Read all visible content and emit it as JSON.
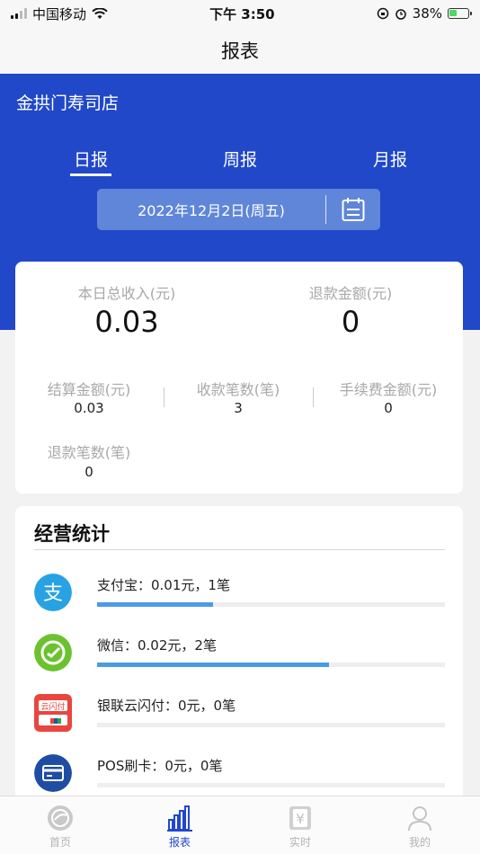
{
  "status_bar": {
    "carrier": "中国移动",
    "time": "下午 3:50",
    "battery": "38%"
  },
  "nav": {
    "title": "报表"
  },
  "store": {
    "name": "金拱门寿司店"
  },
  "tabs": [
    {
      "label": "日报"
    },
    {
      "label": "周报"
    },
    {
      "label": "月报"
    }
  ],
  "date": {
    "value": "2022年12月2日(周五)"
  },
  "summary": {
    "total_income_label": "本日总收入(元)",
    "total_income": "0.03",
    "refund_amount_label": "退款金额(元)",
    "refund_amount": "0",
    "settle_label": "结算金额(元)",
    "settle_value": "0.03",
    "count_label": "收款笔数(笔)",
    "count_value": "3",
    "fee_label": "手续费金额(元)",
    "fee_value": "0",
    "refund_count_label": "退款笔数(笔)",
    "refund_count_value": "0"
  },
  "stats": {
    "title": "经营统计",
    "items": [
      {
        "text": "支付宝：0.01元，1笔",
        "ratio": 0.333,
        "icon": "alipay-icon"
      },
      {
        "text": "微信：0.02元，2笔",
        "ratio": 0.667,
        "icon": "wechat-icon"
      },
      {
        "text": "银联云闪付：0元，0笔",
        "ratio": 0,
        "icon": "unionpay-icon",
        "icon_text": "云闪付"
      },
      {
        "text": "POS刷卡：0元，0笔",
        "ratio": 0,
        "icon": "card-icon"
      }
    ]
  },
  "tabbar": {
    "items": [
      {
        "label": "首页"
      },
      {
        "label": "报表"
      },
      {
        "label": "实时"
      },
      {
        "label": "我的"
      }
    ],
    "active": 1
  },
  "colors": {
    "primary": "#2148c9",
    "progress": "#4a9be6"
  }
}
